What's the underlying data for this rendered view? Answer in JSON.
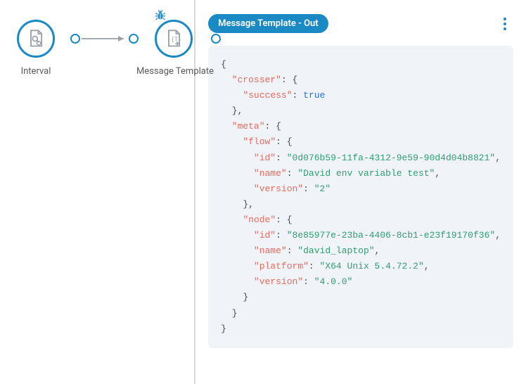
{
  "canvas": {
    "nodes": [
      {
        "id": "interval",
        "label": "Interval"
      },
      {
        "id": "template",
        "label": "Message Template"
      }
    ]
  },
  "detail": {
    "badge": "Message Template - Out",
    "json": {
      "crosser": {
        "success": true
      },
      "meta": {
        "flow": {
          "id": "0d076b59-11fa-4312-9e59-90d4d04b8821",
          "name": "David env variable test",
          "version": "2"
        },
        "node": {
          "id": "8e85977e-23ba-4406-8cb1-e23f19170f36",
          "name": "david_laptop",
          "platform": "X64 Unix 5.4.72.2",
          "version": "4.0.0"
        }
      }
    }
  }
}
